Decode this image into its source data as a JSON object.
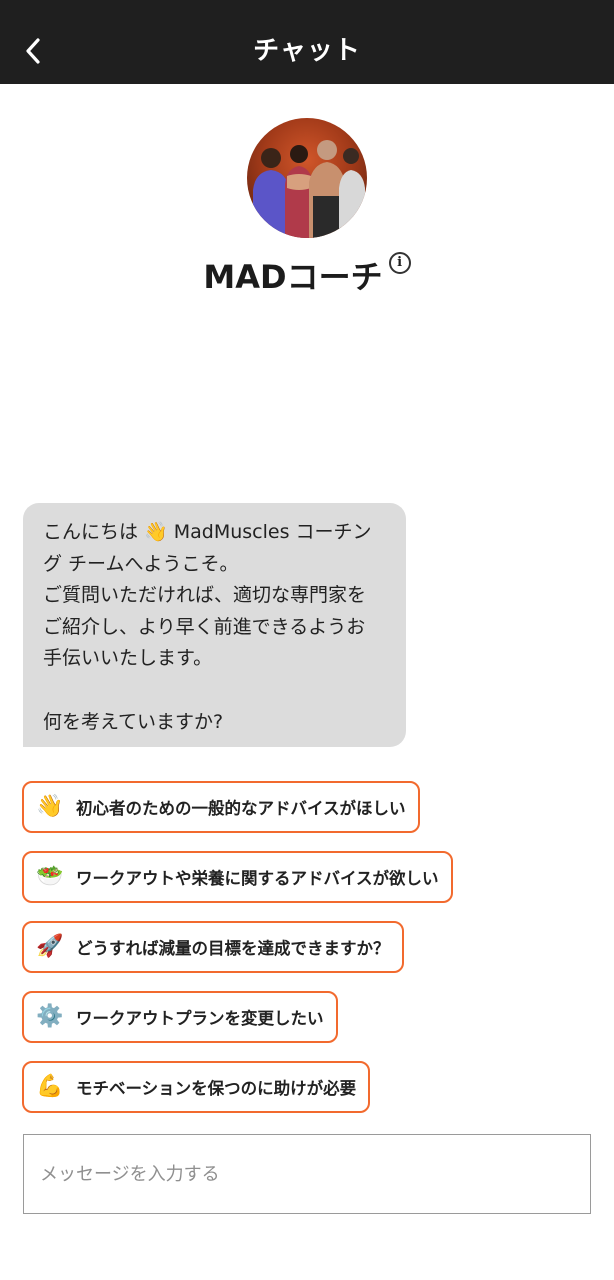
{
  "header": {
    "title": "チャット"
  },
  "coach": {
    "name": "MADコーチ"
  },
  "message": {
    "lines": [
      "こんにちは 👋 MadMuscles コーチン",
      "グ チームへようこそ。",
      "ご質問いただければ、適切な専門家を",
      "ご紹介し、より早く前進できるようお",
      "手伝いいたします。",
      "何を考えていますか?"
    ]
  },
  "suggestions": [
    {
      "emoji": "👋",
      "icon": "waving-hand-icon",
      "label": "初心者のための一般的なアドバイスがほしい"
    },
    {
      "emoji": "🥗",
      "icon": "salad-icon",
      "label": "ワークアウトや栄養に関するアドバイスが欲しい"
    },
    {
      "emoji": "🚀",
      "icon": "rocket-icon",
      "label": "どうすれば減量の目標を達成できますか？"
    },
    {
      "emoji": "⚙️",
      "icon": "gear-icon",
      "label": "ワークアウトプランを変更したい"
    },
    {
      "emoji": "💪",
      "icon": "flexed-biceps-icon",
      "label": "モチベーションを保つのに助けが必要"
    }
  ],
  "input": {
    "placeholder": "メッセージを入力する"
  },
  "colors": {
    "accent": "#f26a2e",
    "header_bg": "#1f1f1f",
    "bubble_bg": "#dcdcdc"
  }
}
